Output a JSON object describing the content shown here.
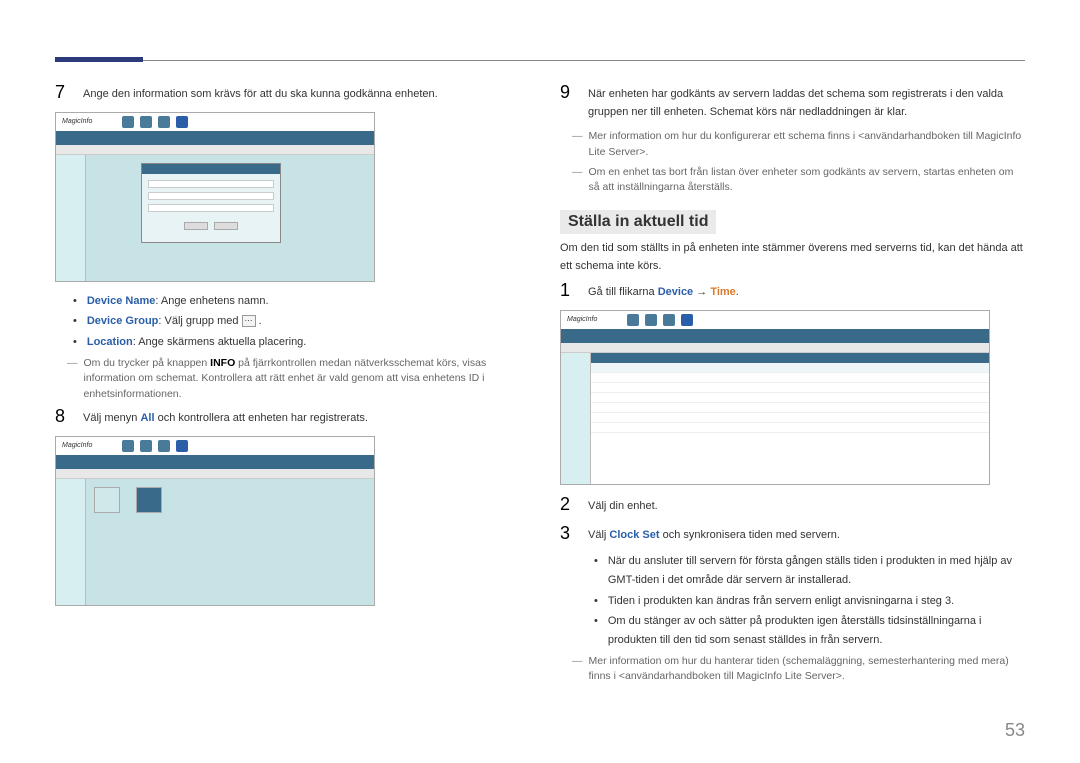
{
  "page_number": "53",
  "left": {
    "step7": "Ange den information som krävs för att du ska kunna godkänna enheten.",
    "ss_brand": "MagicInfo",
    "bullets": {
      "dn_label": "Device Name",
      "dn_text": ": Ange enhetens namn.",
      "dg_label": "Device Group",
      "dg_text_a": ": Välj grupp med ",
      "dg_text_b": " .",
      "loc_label": "Location",
      "loc_text": ": Ange skärmens aktuella placering."
    },
    "note1_a": "Om du trycker på knappen ",
    "note1_b": "INFO",
    "note1_c": " på fjärrkontrollen medan nätverksschemat körs, visas information om schemat. Kontrollera att rätt enhet är vald genom att visa enhetens ID i enhetsinformationen.",
    "step8_a": "Välj menyn ",
    "step8_b": "All",
    "step8_c": " och kontrollera att enheten har registrerats."
  },
  "right": {
    "step9": "När enheten har godkänts av servern laddas det schema som registrerats i den valda gruppen ner till enheten. Schemat körs när nedladdningen är klar.",
    "note2": "Mer information om hur du konfigurerar ett schema finns i <användarhandboken till MagicInfo Lite Server>.",
    "note3": "Om en enhet tas bort från listan över enheter som godkänts av servern, startas enheten om så att inställningarna återställs.",
    "heading": "Ställa in aktuell tid",
    "intro": "Om den tid som ställts in på enheten inte stämmer överens med serverns tid, kan det hända att ett schema inte körs.",
    "step1_a": "Gå till flikarna ",
    "step1_b": "Device",
    "step1_c": " → ",
    "step1_d": "Time",
    "step1_e": ".",
    "step2": "Välj din enhet.",
    "step3_a": "Välj ",
    "step3_b": "Clock Set",
    "step3_c": " och synkronisera tiden med servern.",
    "bul1": "När du ansluter till servern för första gången ställs tiden i produkten in med hjälp av GMT-tiden i det område där servern är installerad.",
    "bul2": "Tiden i produkten kan ändras från servern enligt anvisningarna i steg 3.",
    "bul3": "Om du stänger av och sätter på produkten igen återställs tidsinställningarna i produkten till den tid som senast ställdes in från servern.",
    "note4": "Mer information om hur du hanterar tiden (schemaläggning, semesterhantering med mera) finns i <användarhandboken till MagicInfo Lite Server>."
  }
}
